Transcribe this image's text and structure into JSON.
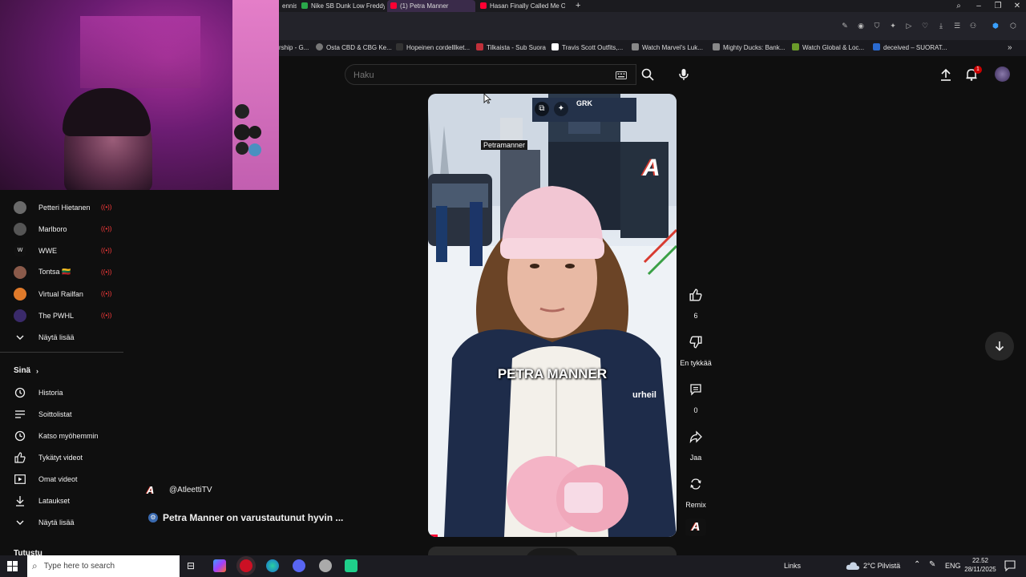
{
  "browser": {
    "tabs": [
      {
        "label": "ennis F",
        "color": "#444"
      },
      {
        "label": "Nike SB Dunk Low Freddy",
        "color": "#2aa84a"
      },
      {
        "label": "(1) Petra Manner",
        "color": "#ff0033",
        "active": true
      },
      {
        "label": "Hasan Finally Called Me O",
        "color": "#ff0033"
      }
    ],
    "new_tab": "+",
    "bookmarks": [
      {
        "label": "rship - G...",
        "color": "#555"
      },
      {
        "label": "Osta CBD & CBG Ke...",
        "color": "#777"
      },
      {
        "label": "Hopeinen cordelllket...",
        "color": "#333"
      },
      {
        "label": "Tilkaista - Sub Suora",
        "color": "#c0303a"
      },
      {
        "label": "Travis Scott Outfits,...",
        "color": "#fff"
      },
      {
        "label": "Watch Marvel's Luk...",
        "color": "#888"
      },
      {
        "label": "Mighty Ducks: Bank...",
        "color": "#888"
      },
      {
        "label": "Watch Global & Loc...",
        "color": "#6a9a2a"
      },
      {
        "label": "deceived – SUORAT...",
        "color": "#2a6ad0"
      }
    ]
  },
  "search": {
    "placeholder": "Haku"
  },
  "notifications": {
    "count": "1"
  },
  "sidebar": {
    "subscriptions": [
      {
        "label": "Petteri Hietanen",
        "live": "((•))",
        "color": "#6a6a6a"
      },
      {
        "label": "Marlboro",
        "live": "((•))",
        "color": "#555"
      },
      {
        "label": "WWE",
        "live": "((•))",
        "color": "#111"
      },
      {
        "label": "Tontsa 🇱🇹",
        "live": "((•))",
        "color": "#8a5a4a"
      },
      {
        "label": "Virtual Railfan",
        "live": "((•))",
        "color": "#e07a2a"
      },
      {
        "label": "The PWHL",
        "live": "((•))",
        "color": "#3a2a6a"
      }
    ],
    "show_more": "Näytä lisää",
    "you_header": "Sinä",
    "you_items": [
      {
        "label": "Historia",
        "icon": "history-icon"
      },
      {
        "label": "Soittolistat",
        "icon": "playlists-icon"
      },
      {
        "label": "Katso myöhemmin",
        "icon": "watch-later-icon"
      },
      {
        "label": "Tykätyt videot",
        "icon": "liked-icon"
      },
      {
        "label": "Omat videot",
        "icon": "your-videos-icon"
      },
      {
        "label": "Lataukset",
        "icon": "downloads-icon"
      }
    ],
    "show_more_2": "Näytä lisää",
    "explore_header": "Tutustu"
  },
  "short": {
    "overlay_name": "Petramanner",
    "caption": "PETRA MANNER",
    "channel": "@AtleettiTV",
    "title": "Petra Manner on varustautunut hyvin ...",
    "logo_text": "A",
    "jacket_text": "urheil"
  },
  "actions": {
    "like_count": "6",
    "dislike_label": "En tykkää",
    "comments_count": "0",
    "share_label": "Jaa",
    "remix_label": "Remix"
  },
  "taskbar": {
    "search_placeholder": "Type here to search",
    "links": "Links",
    "weather": "2°C  Pilvistä",
    "lang": "ENG",
    "time": "22.52",
    "date": "28/11/2025"
  },
  "colors": {
    "accent_red": "#ff0033",
    "bg": "#0f0f0f"
  }
}
